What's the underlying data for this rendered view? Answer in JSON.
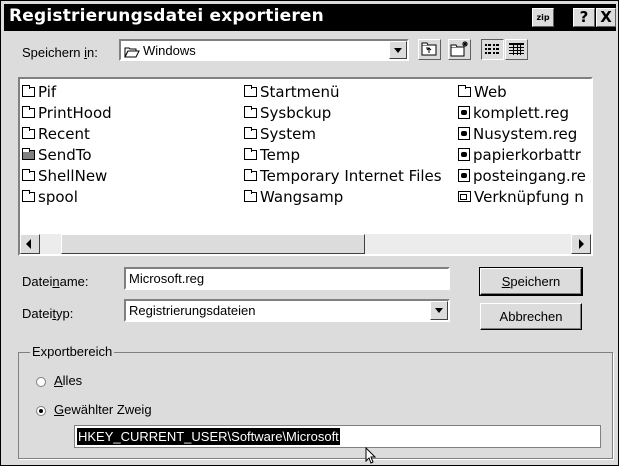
{
  "window": {
    "title": "Registrierungsdatei exportieren",
    "zip_button_label": "zip",
    "help_button_label": "?",
    "close_button_label": "X"
  },
  "save_in": {
    "label_pre": "Speichern ",
    "label_accel": "i",
    "label_post": "n:",
    "value": "Windows",
    "toolbar_icons": [
      "up-one-level-icon",
      "create-new-folder-icon",
      "list-view-icon",
      "details-view-icon"
    ]
  },
  "file_list": {
    "columns": [
      [
        {
          "name": "Pif",
          "icon": "folder-icon"
        },
        {
          "name": "PrintHood",
          "icon": "folder-icon"
        },
        {
          "name": "Recent",
          "icon": "folder-icon"
        },
        {
          "name": "SendTo",
          "icon": "folder-icon-dark"
        },
        {
          "name": "ShellNew",
          "icon": "folder-icon"
        },
        {
          "name": "spool",
          "icon": "folder-icon"
        }
      ],
      [
        {
          "name": "Startmenü",
          "icon": "folder-icon"
        },
        {
          "name": "Sysbckup",
          "icon": "folder-icon"
        },
        {
          "name": "System",
          "icon": "folder-icon"
        },
        {
          "name": "Temp",
          "icon": "folder-icon"
        },
        {
          "name": "Temporary Internet Files",
          "icon": "folder-icon"
        },
        {
          "name": "Wangsamp",
          "icon": "folder-icon"
        }
      ],
      [
        {
          "name": "Web",
          "icon": "folder-icon"
        },
        {
          "name": "komplett.reg",
          "icon": "registry-file-icon"
        },
        {
          "name": "Nusystem.reg",
          "icon": "registry-file-icon"
        },
        {
          "name": "papierkorbattr",
          "icon": "registry-file-icon"
        },
        {
          "name": "posteingang.re",
          "icon": "registry-file-icon"
        },
        {
          "name": "Verknüpfung n",
          "icon": "shortcut-icon"
        }
      ]
    ]
  },
  "filename": {
    "label_pre": "Datei",
    "label_accel": "n",
    "label_post": "ame:",
    "value": "Microsoft.reg"
  },
  "filetype": {
    "label_pre": "Datei",
    "label_accel": "t",
    "label_post": "yp:",
    "value": "Registrierungsdateien"
  },
  "buttons": {
    "save_accel": "S",
    "save_rest": "peichern",
    "cancel": "Abbrechen"
  },
  "export_range": {
    "legend": "Exportbereich",
    "all_accel": "A",
    "all_rest": "lles",
    "branch_accel": "G",
    "branch_rest": "ewählter Zweig",
    "selected": "branch",
    "key_path": "HKEY_CURRENT_USER\\Software\\Microsoft"
  }
}
